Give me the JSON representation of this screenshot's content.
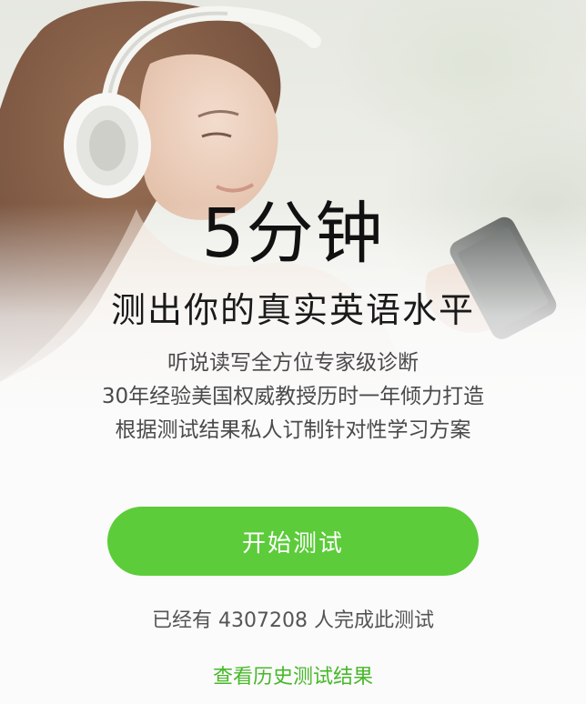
{
  "hero": {
    "title": "5分钟",
    "subtitle": "测出你的真实英语水平",
    "descriptions": [
      "听说读写全方位专家级诊断",
      "30年经验美国权威教授历时一年倾力打造",
      "根据测试结果私人订制针对性学习方案"
    ]
  },
  "actions": {
    "start_label": "开始测试",
    "history_label": "查看历史测试结果"
  },
  "stats": {
    "prefix": "已经有",
    "count": "4307208",
    "suffix": "人完成此测试"
  },
  "colors": {
    "accent": "#5ccc3a",
    "link": "#47b829",
    "title": "#111111",
    "body": "#4a4a4a"
  },
  "icons": {
    "headphones": "headphones-icon",
    "phone": "phone-icon"
  }
}
